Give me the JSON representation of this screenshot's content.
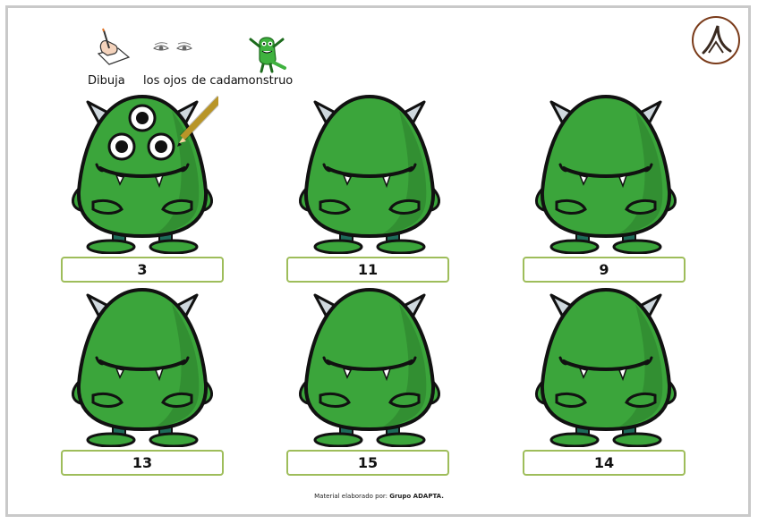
{
  "header": {
    "words": [
      "Dibuja",
      "los ojos",
      "de cada",
      "monstruo"
    ],
    "icons": [
      "drawing-hand-icon",
      "eyes-icon",
      "green-monster-icon"
    ]
  },
  "logo": {
    "icon": "adapta-logo-icon"
  },
  "monsters": [
    {
      "number": "3",
      "eyes_drawn": 3,
      "has_pencil": true
    },
    {
      "number": "11",
      "eyes_drawn": 0,
      "has_pencil": false
    },
    {
      "number": "9",
      "eyes_drawn": 0,
      "has_pencil": false
    },
    {
      "number": "13",
      "eyes_drawn": 0,
      "has_pencil": false
    },
    {
      "number": "15",
      "eyes_drawn": 0,
      "has_pencil": false
    },
    {
      "number": "14",
      "eyes_drawn": 0,
      "has_pencil": false
    }
  ],
  "footer": {
    "prefix": "Material elaborado por:",
    "author": "Grupo ADAPTA."
  },
  "colors": {
    "monster_green": "#3ba53b",
    "monster_dark": "#2b7d2b",
    "box_border": "#9ebd5a",
    "frame": "#c9c9c9"
  }
}
